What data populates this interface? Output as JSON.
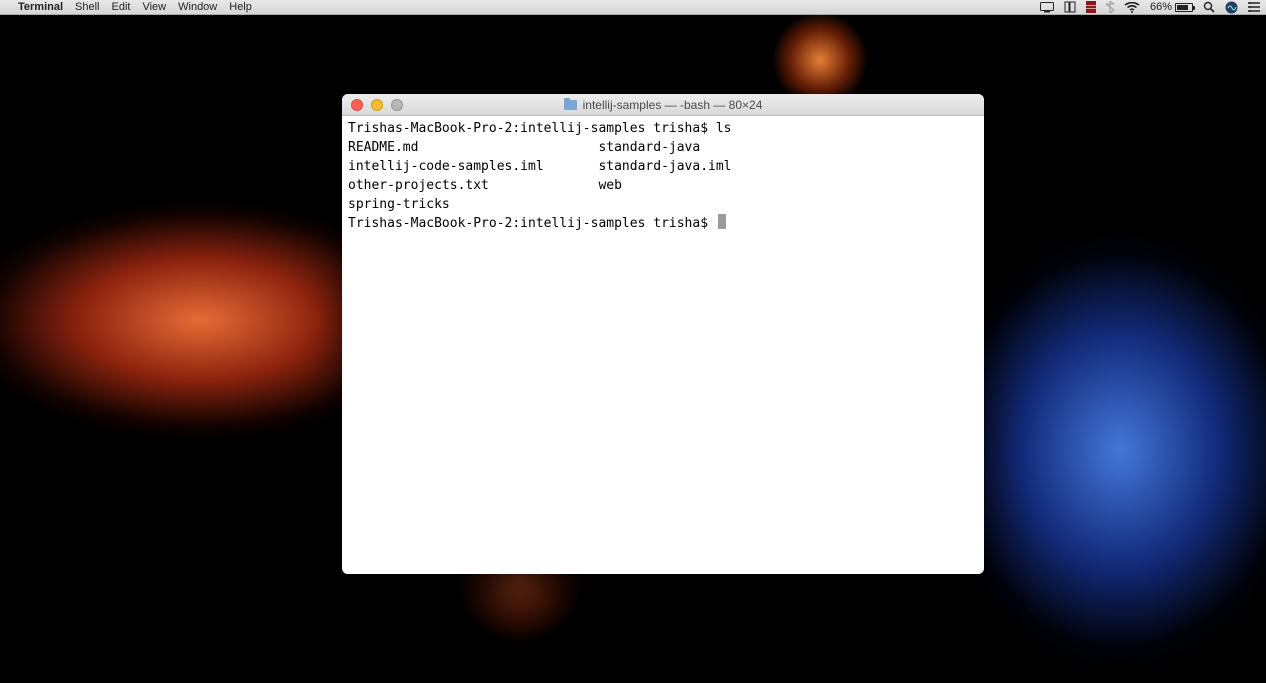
{
  "menubar": {
    "app_name": "Terminal",
    "items": [
      "Shell",
      "Edit",
      "View",
      "Window",
      "Help"
    ],
    "battery_percent": "66%"
  },
  "window": {
    "title": "intellij-samples — -bash — 80×24"
  },
  "terminal": {
    "prompt1": "Trishas-MacBook-Pro-2:intellij-samples trisha$ ",
    "cmd1": "ls",
    "ls_col1": [
      "README.md",
      "intellij-code-samples.iml",
      "other-projects.txt",
      "spring-tricks"
    ],
    "ls_col2": [
      "standard-java",
      "standard-java.iml",
      "web"
    ],
    "prompt2": "Trishas-MacBook-Pro-2:intellij-samples trisha$ "
  }
}
